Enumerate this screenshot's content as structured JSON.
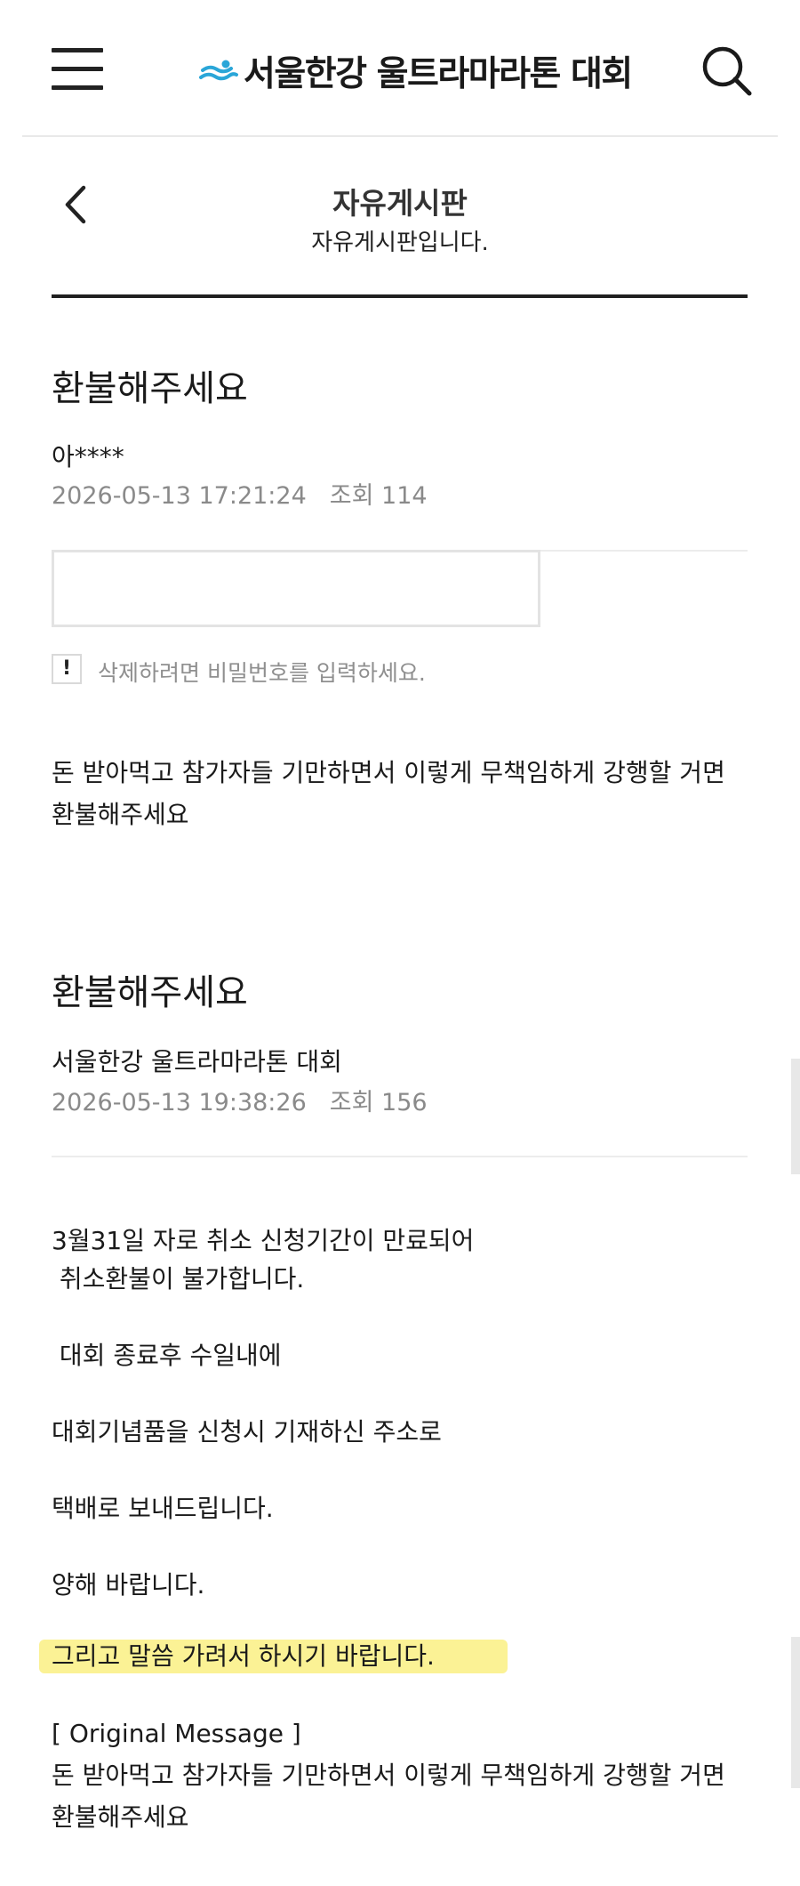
{
  "header": {
    "site_name": "서울한강 울트라마라톤 대회",
    "logo_icon": "swimmer-icon",
    "menu_icon": "hamburger-menu-icon",
    "search_icon": "search-icon",
    "accent_color": "#2aa6d8"
  },
  "board": {
    "title": "자유게시판",
    "subtitle": "자유게시판입니다."
  },
  "post": {
    "title": "환불해주세요",
    "author": "아****",
    "date": "2026-05-13 17:21:24",
    "views": "조회 114",
    "password_placeholder": "",
    "delete_notice": "삭제하려면 비밀번호를 입력하세요.",
    "body": "돈 받아먹고 참가자들 기만하면서 이렇게 무책임하게 강행할 거면 환불해주세요"
  },
  "reply": {
    "title": "환불해주세요",
    "author": "서울한강 울트라마라톤 대회",
    "date": "2026-05-13 19:38:26",
    "views": "조회 156",
    "lines": [
      "3월31일 자로 취소 신청기간이 만료되어",
      " 취소환불이 불가합니다.",
      " 대회 종료후 수일내에",
      "대회기념품을 신청시 기재하신 주소로",
      "택배로 보내드립니다.",
      "양해 바랍니다."
    ],
    "highlighted": "그리고 말씀 가려서 하시기 바랍니다.",
    "highlight_color": "#fbf295",
    "original_label": "[ Original Message ]",
    "original_body": "돈 받아먹고 참가자들 기만하면서 이렇게 무책임하게 강행할 거면 환불해주세요"
  }
}
